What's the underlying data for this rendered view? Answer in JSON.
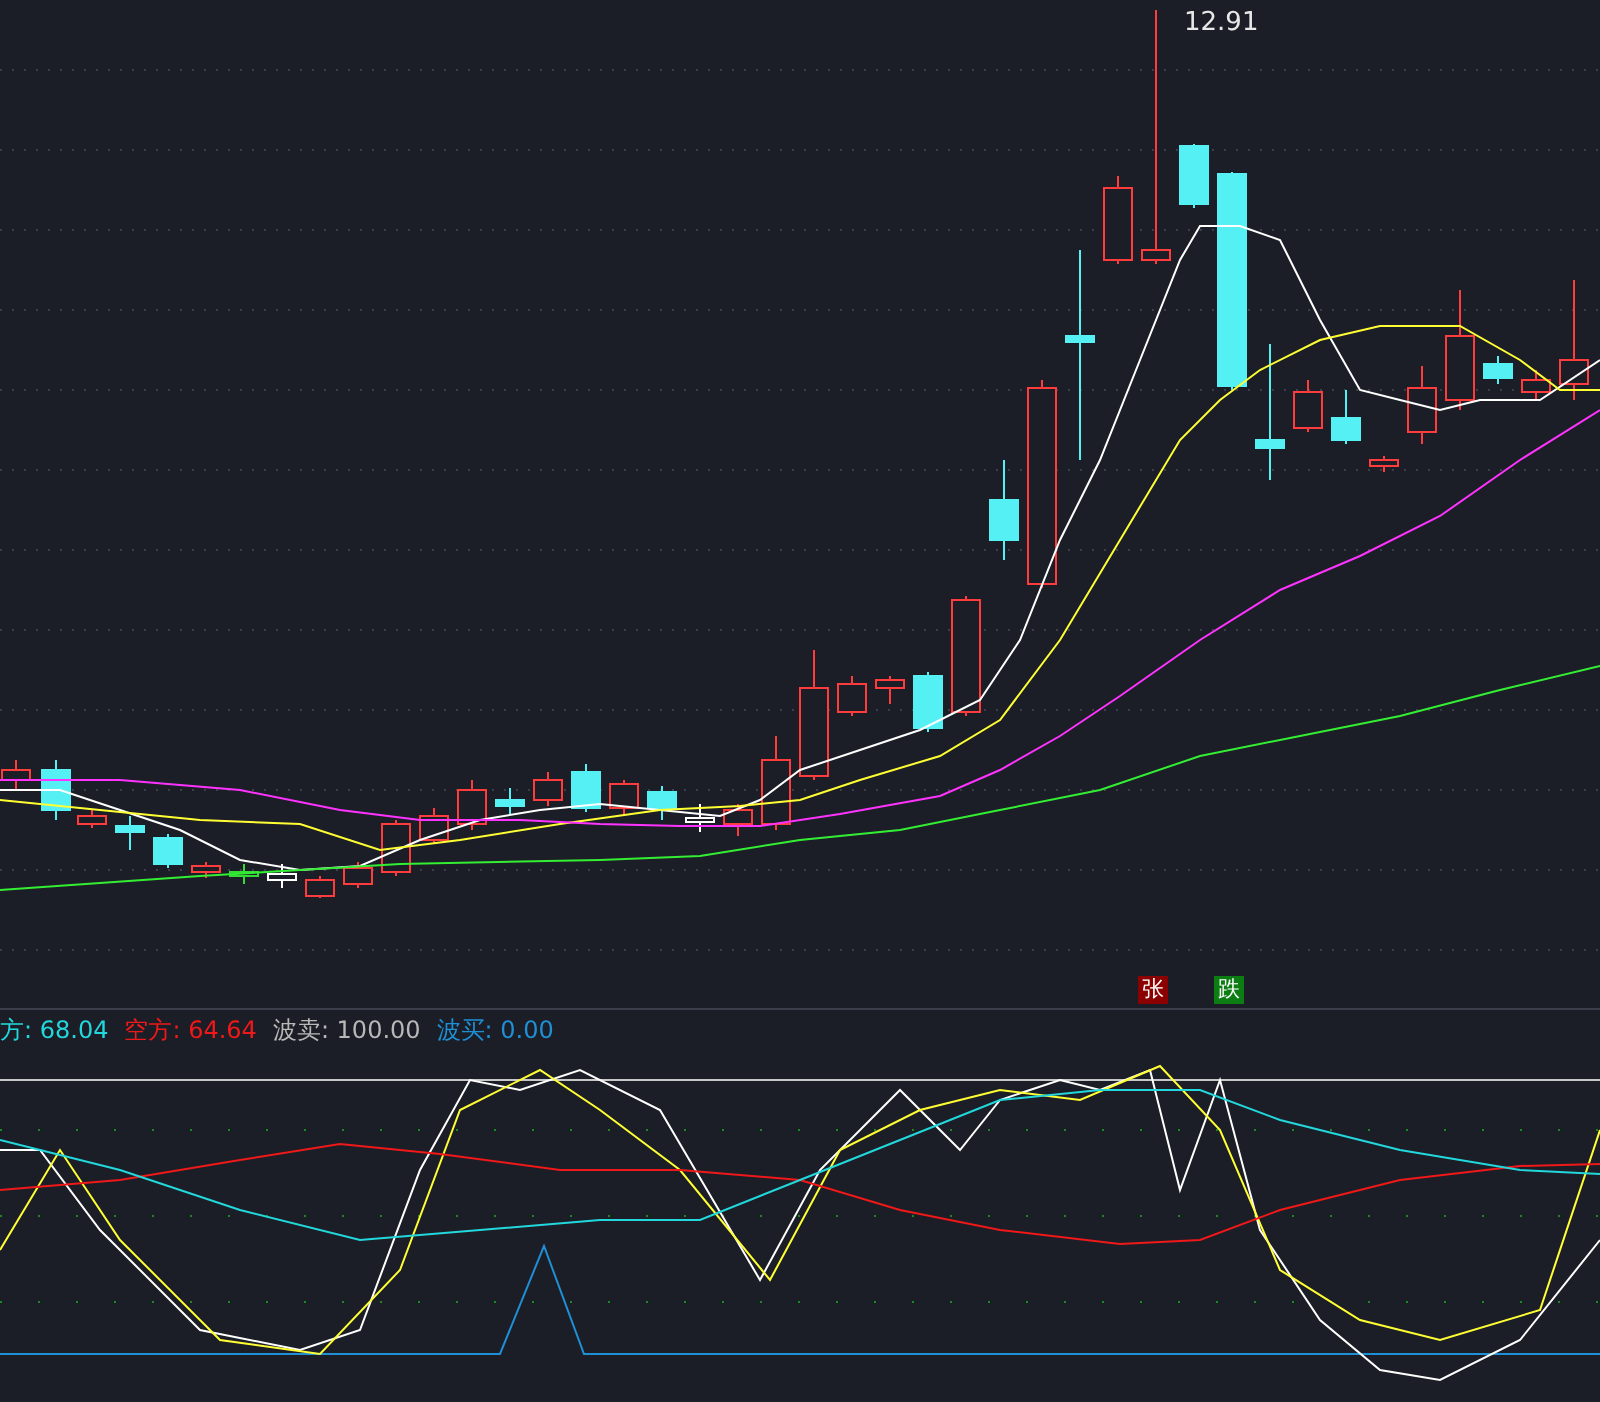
{
  "main_chart": {
    "high_label": "12.91",
    "signals": [
      {
        "text": "张",
        "color": "#8b0000"
      },
      {
        "text": "跌",
        "color": "#0b7d12"
      }
    ]
  },
  "indicator": {
    "legend": [
      {
        "label": "方: 68.04",
        "color": "#22d8dc"
      },
      {
        "label": "空方: 64.64",
        "color": "#f01818"
      },
      {
        "label": "波卖: 100.00",
        "color": "#b8b8b8"
      },
      {
        "label": "波买: 0.00",
        "color": "#1f8fd6"
      }
    ]
  }
}
